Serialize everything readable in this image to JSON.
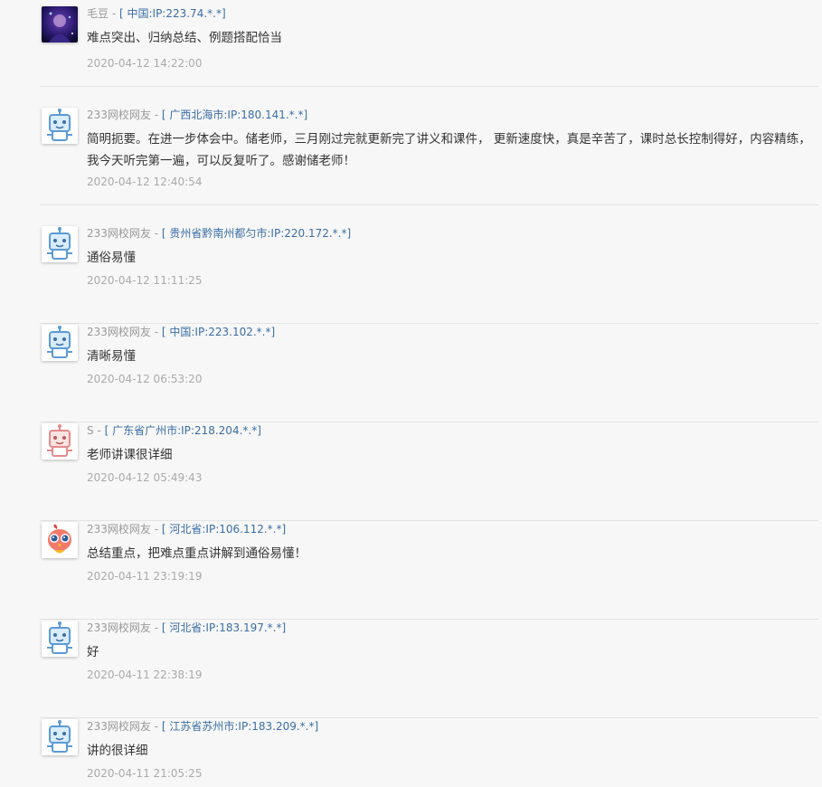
{
  "comments": [
    {
      "user": "毛豆",
      "separator": " - ",
      "location": "[ 中国:IP:223.74.*.*]",
      "content": "难点突出、归纳总结、例题搭配恰当",
      "time": "2020-04-12 14:22:00",
      "avatar": "photo-avatar"
    },
    {
      "user": "233网校网友",
      "separator": " - ",
      "location": "[ 广西北海市:IP:180.141.*.*]",
      "content": "简明扼要。在进一步体会中。储老师，三月刚过完就更新完了讲义和课件， 更新速度快，真是辛苦了，课时总长控制得好，内容精练，我今天听完第一遍，可以反复听了。感谢储老师！",
      "time": "2020-04-12 12:40:54",
      "avatar": "robot-avatar-blue"
    },
    {
      "user": "233网校网友",
      "separator": " - ",
      "location": "[ 贵州省黔南州都匀市:IP:220.172.*.*]",
      "content": "通俗易懂",
      "time": "2020-04-12 11:11:25",
      "avatar": "robot-avatar-blue"
    },
    {
      "user": "233网校网友",
      "separator": " - ",
      "location": "[ 中国:IP:223.102.*.*]",
      "content": "清晰易懂",
      "time": "2020-04-12 06:53:20",
      "avatar": "robot-avatar-blue"
    },
    {
      "user": "S",
      "separator": " - ",
      "location": "[ 广东省广州市:IP:218.204.*.*]",
      "content": "老师讲课很详细",
      "time": "2020-04-12 05:49:43",
      "avatar": "robot-avatar-pink"
    },
    {
      "user": "233网校网友",
      "separator": " - ",
      "location": "[ 河北省:IP:106.112.*.*]",
      "content": "总结重点，把难点重点讲解到通俗易懂！",
      "time": "2020-04-11 23:19:19",
      "avatar": "bird-avatar"
    },
    {
      "user": "233网校网友",
      "separator": " - ",
      "location": "[ 河北省:IP:183.197.*.*]",
      "content": "好",
      "time": "2020-04-11 22:38:19",
      "avatar": "robot-avatar-blue"
    },
    {
      "user": "233网校网友",
      "separator": " - ",
      "location": "[ 江苏省苏州市:IP:183.209.*.*]",
      "content": "讲的很详细",
      "time": "2020-04-11 21:05:25",
      "avatar": "robot-avatar-blue"
    }
  ],
  "colors": {
    "location_link": "#3a6ea5",
    "meta_text": "#999999",
    "content_text": "#333333",
    "time_text": "#aaaaaa",
    "robot_blue": "#5b9bd5",
    "robot_pink": "#e58a8a"
  }
}
